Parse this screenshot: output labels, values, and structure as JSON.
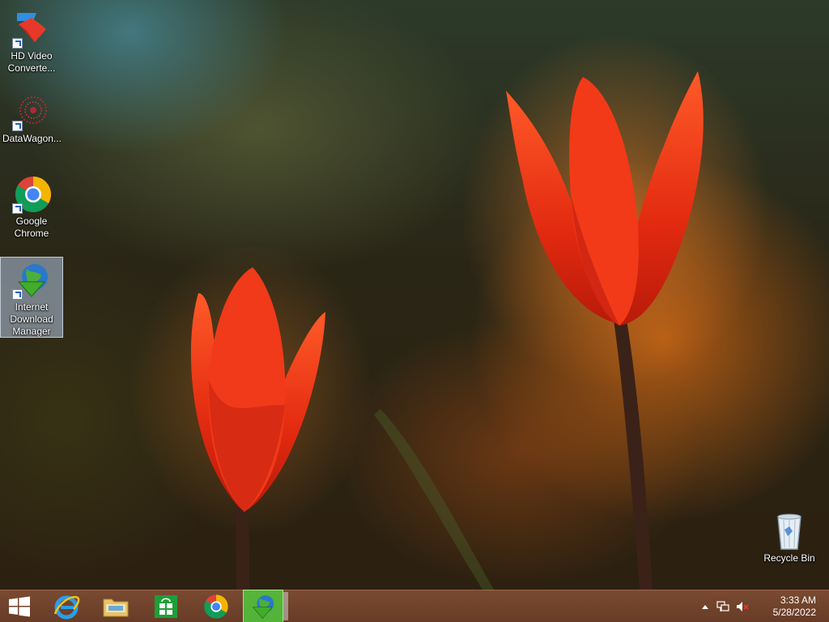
{
  "desktop": {
    "icons": [
      {
        "label": "HD Video\nConverte..."
      },
      {
        "label": "DataWagon..."
      },
      {
        "label": "Google\nChrome"
      },
      {
        "label": "Internet\nDownload\nManager"
      },
      {
        "label": "Recycle Bin"
      }
    ]
  },
  "taskbar": {
    "start_icon": "windows-logo-icon",
    "pinned": [
      {
        "name": "Internet Explorer",
        "icon": "internet-explorer-icon"
      },
      {
        "name": "File Explorer",
        "icon": "folder-icon"
      },
      {
        "name": "Store",
        "icon": "store-icon"
      },
      {
        "name": "Google Chrome",
        "icon": "chrome-icon"
      },
      {
        "name": "Internet Download Manager",
        "icon": "idm-icon",
        "active": true
      }
    ]
  },
  "tray": {
    "time": "3:33 AM",
    "date": "5/28/2022"
  },
  "colors": {
    "taskbar": "#74432b",
    "active_task": "#50c83c",
    "selection": "#b4c8e6"
  }
}
